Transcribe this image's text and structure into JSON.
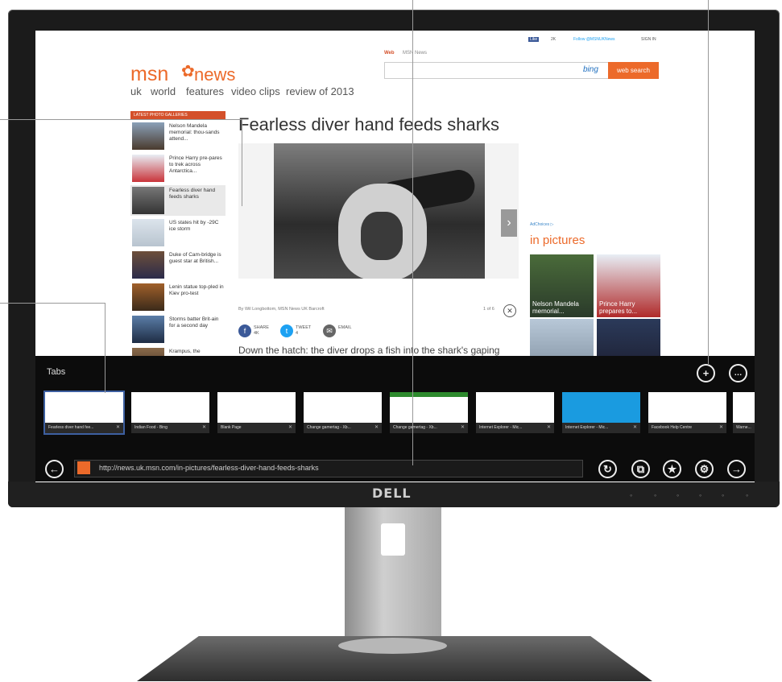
{
  "site": {
    "logo_msn": "msn",
    "logo_news": "news",
    "nav": [
      "uk",
      "world",
      "features",
      "video clips",
      "review of 2013"
    ],
    "search_tabs": [
      "Web",
      "MSN News"
    ],
    "search_engine": "bing",
    "search_button": "web search",
    "social": {
      "like": "Like",
      "like_count": "2K",
      "follow": "Follow @MSNUKNews",
      "signin": "SIGN IN"
    }
  },
  "gallery": {
    "header": "LATEST PHOTO GALLERIES",
    "items": [
      {
        "text": "Nelson Mandela memorial: thou-sands attend..."
      },
      {
        "text": "Prince Harry pre-pares to trek across Antarctica..."
      },
      {
        "text": "Fearless diver hand feeds sharks"
      },
      {
        "text": "US states hit by -29C ice storm"
      },
      {
        "text": "Duke of Cam-bridge is guest star at British..."
      },
      {
        "text": "Lenin statue top-pled in Kiev pro-test"
      },
      {
        "text": "Storms batter Brit-ain for a second day"
      },
      {
        "text": "Krampus, the"
      }
    ]
  },
  "article": {
    "title": "Fearless diver hand feeds sharks",
    "byline": "By Wil Longbottom, MSN News UK Barcroft",
    "counter": "1 of 6",
    "share": {
      "share_label": "SHARE",
      "share_count": "4K",
      "tweet_label": "TWEET",
      "tweet_count": "4",
      "email_label": "EMAIL"
    },
    "caption": "Down the hatch: the diver drops a fish into the shark's gaping"
  },
  "sidebar": {
    "adchoices": "AdChoices ▷",
    "section_title": "in pictures",
    "pictures": [
      {
        "caption": "Nelson Mandela memorial..."
      },
      {
        "caption": "Prince Harry prepares to..."
      },
      {
        "caption": ""
      },
      {
        "caption": ""
      }
    ]
  },
  "appbar": {
    "tabs_label": "Tabs",
    "tabs": [
      {
        "title": "Fearless diver hand fee..."
      },
      {
        "title": "Indian Food - Bing"
      },
      {
        "title": "Blank Page"
      },
      {
        "title": "Change gamertag - Xb..."
      },
      {
        "title": "Change gamertag - Xb..."
      },
      {
        "title": "Internet Explorer - Mic..."
      },
      {
        "title": "Internet Explorer - Mic..."
      },
      {
        "title": "Facebook Help Centre"
      },
      {
        "title": "Warne..."
      }
    ],
    "tab_close": "✕",
    "url": "http://news.uk.msn.com/in-pictures/fearless-diver-hand-feeds-sharks",
    "buttons": {
      "new_tab": "+",
      "more": "…",
      "back": "←",
      "refresh": "↻",
      "pin": "⧉",
      "favorite": "★",
      "tools": "⚙",
      "forward": "→"
    }
  },
  "monitor": {
    "brand": "DELL"
  },
  "colors": {
    "accent": "#ec6a2a",
    "appbar_bg": "#0c0c0c",
    "active_tab_outline": "#3d5fa0"
  }
}
